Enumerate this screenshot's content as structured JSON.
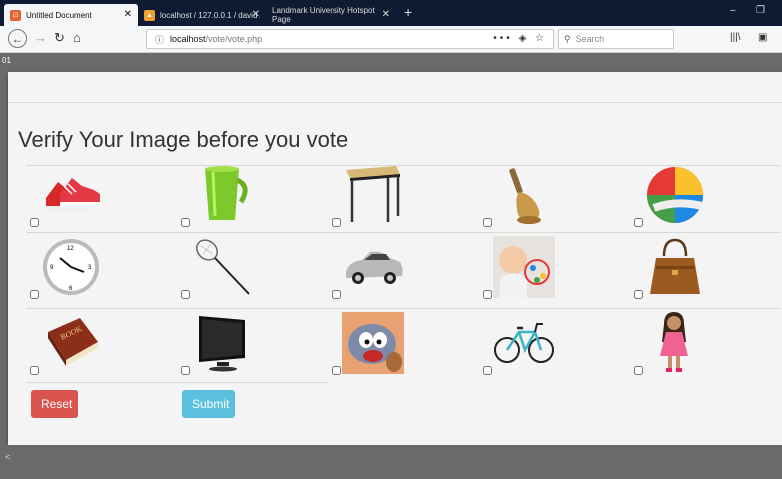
{
  "browser": {
    "tabs": [
      {
        "title": "Untitled Document",
        "active": true,
        "favicon_color": "#e8612c"
      },
      {
        "title": "localhost / 127.0.0.1 / david / i",
        "active": false,
        "favicon_color": "#f0a030"
      },
      {
        "title": "Landmark University Hotspot Page",
        "active": false,
        "favicon_color": ""
      }
    ],
    "new_tab": "+",
    "window_controls": {
      "minimize": "–",
      "restore": "❐"
    },
    "url": {
      "host": "localhost",
      "path": "/vote/vote.php"
    },
    "url_actions": "••• ◈ ☆",
    "search_placeholder": "Search"
  },
  "top_number": "01",
  "page": {
    "title": "Verify Your Image before you vote",
    "images": [
      {
        "icon": "sneakers-icon"
      },
      {
        "icon": "mug-icon"
      },
      {
        "icon": "table-icon"
      },
      {
        "icon": "bell-icon"
      },
      {
        "icon": "ball-icon"
      },
      {
        "icon": "clock-icon"
      },
      {
        "icon": "racket-icon"
      },
      {
        "icon": "car-icon"
      },
      {
        "icon": "baby-icon"
      },
      {
        "icon": "handbag-icon"
      },
      {
        "icon": "book-icon"
      },
      {
        "icon": "monitor-icon"
      },
      {
        "icon": "cartoon-icon"
      },
      {
        "icon": "bicycle-icon"
      },
      {
        "icon": "doll-icon"
      }
    ],
    "reset_label": "Reset",
    "submit_label": "Submit",
    "colors": {
      "reset": "#d9534f",
      "submit": "#5bc0de"
    }
  },
  "bottom_arrow": "<"
}
